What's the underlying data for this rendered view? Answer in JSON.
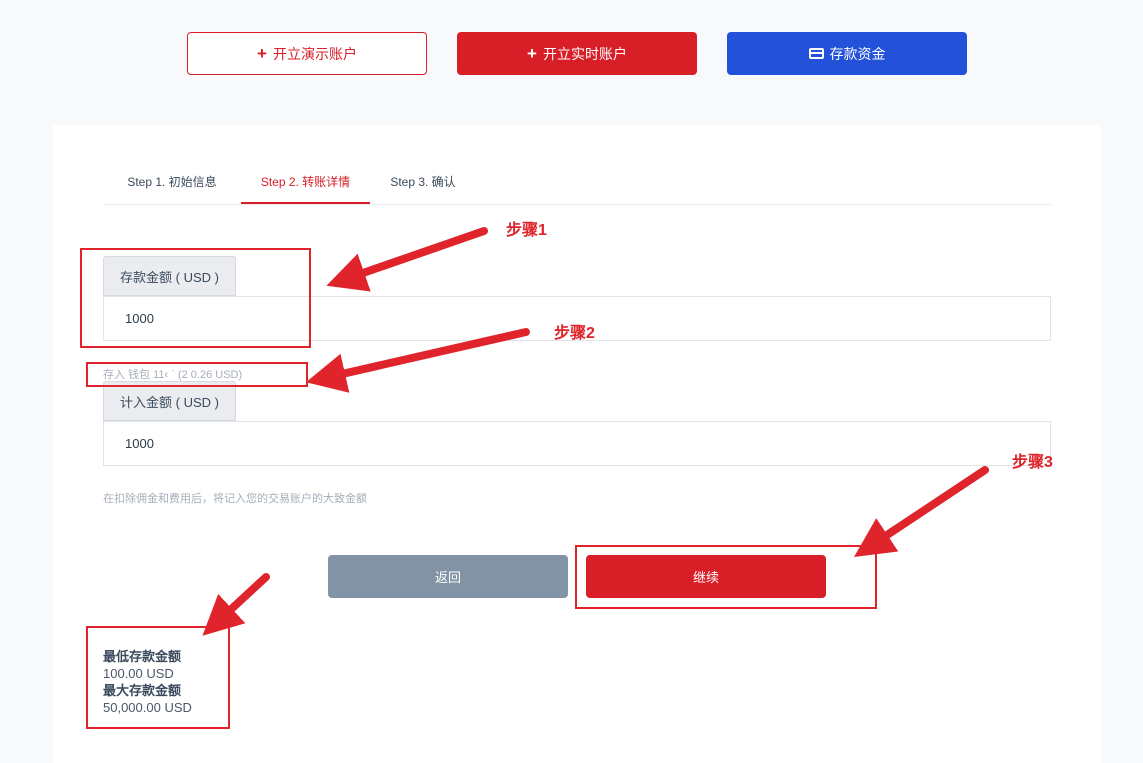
{
  "top_buttons": {
    "demo_label": "开立演示账户",
    "live_label": "开立实时账户",
    "deposit_label": "存款资金"
  },
  "tabs": [
    {
      "label": "Step 1. 初始信息",
      "active": false
    },
    {
      "label": "Step 2. 转账详情",
      "active": true
    },
    {
      "label": "Step 3. 确认",
      "active": false
    }
  ],
  "deposit": {
    "label": "存款金额 ( USD )",
    "value": "1000",
    "wallet_hint": "存入 钱包 11‹ ˈ (2 0.26 USD)"
  },
  "credit": {
    "label": "计入金额 ( USD )",
    "value": "1000",
    "note": "在扣除佣金和费用后，将记入您的交易账户的大致金额"
  },
  "actions": {
    "back_label": "返回",
    "continue_label": "继续"
  },
  "limits": {
    "min_label": "最低存款金额",
    "min_value": "100.00 USD",
    "max_label": "最大存款金额",
    "max_value": "50,000.00 USD"
  },
  "annotations": {
    "step1": "步骤1",
    "step2": "步骤2",
    "step3": "步骤3"
  },
  "colors": {
    "brand_red": "#d81e27",
    "brand_blue": "#2451d9",
    "back_gray": "#8393a6",
    "annotation_red": "#e0242c"
  }
}
